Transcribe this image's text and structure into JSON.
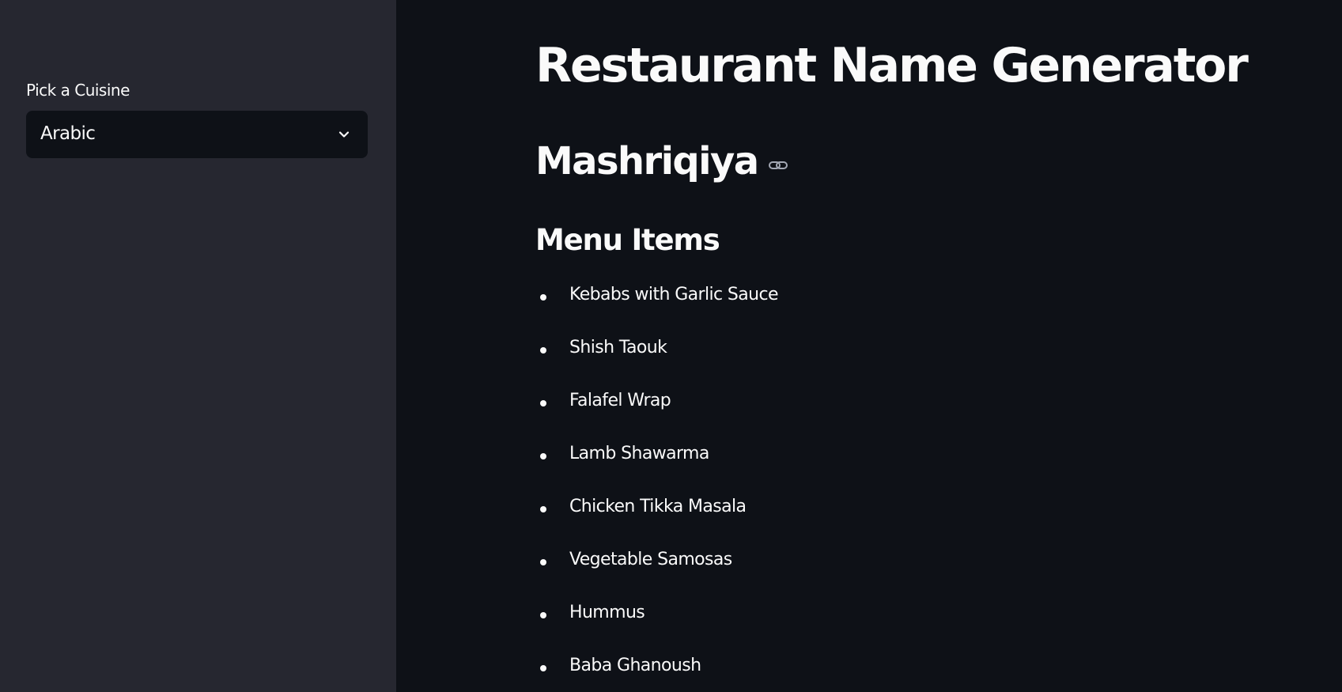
{
  "sidebar": {
    "cuisine_label": "Pick a Cuisine",
    "cuisine_select": {
      "value": "Arabic",
      "icon": "chevron-down-icon"
    }
  },
  "main": {
    "title": "Restaurant Name Generator",
    "restaurant_name": "Mashriqiya",
    "anchor_icon": "link-icon",
    "menu_heading": "Menu Items",
    "menu_items": [
      "Kebabs with Garlic Sauce",
      "Shish Taouk",
      "Falafel Wrap",
      "Lamb Shawarma",
      "Chicken Tikka Masala",
      "Vegetable Samosas",
      "Hummus",
      "Baba Ghanoush"
    ]
  },
  "colors": {
    "sidebar_bg": "#262730",
    "main_bg": "#0e1117",
    "text": "#fafafa"
  }
}
